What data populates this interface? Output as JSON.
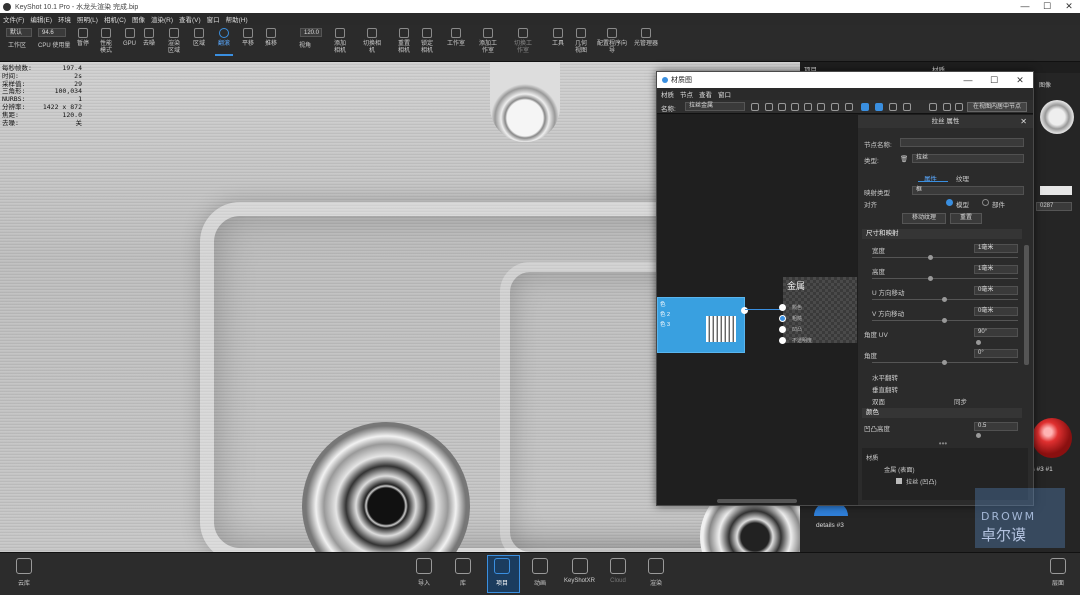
{
  "app": {
    "title": "KeyShot 10.1 Pro - 水龙头渲染 完成.bip"
  },
  "window_controls": [
    "—",
    "☐",
    "✕"
  ],
  "menu": [
    "文件(F)",
    "编辑(E)",
    "环境",
    "照明(L)",
    "相机(C)",
    "图像",
    "渲染(R)",
    "查看(V)",
    "窗口",
    "帮助(H)"
  ],
  "toolbar": {
    "workspace_select": "默认",
    "zoom_value": "94.6",
    "cpu_label": "CPU",
    "threshold_value": "120.0",
    "items": [
      {
        "label": "工作区"
      },
      {
        "label": "CPU 使用量"
      },
      {
        "label": "暂停"
      },
      {
        "label": "性能模式"
      },
      {
        "label": "GPU"
      },
      {
        "label": "去噪"
      },
      {
        "label": "渲染区域"
      },
      {
        "label": "区域"
      },
      {
        "label": "翻滚"
      },
      {
        "label": "平移"
      },
      {
        "label": "推移"
      },
      {
        "label": "视角"
      },
      {
        "label": "添加相机"
      },
      {
        "label": "切换相机"
      },
      {
        "label": "重置相机"
      },
      {
        "label": "锁定相机"
      },
      {
        "label": "工作室"
      },
      {
        "label": "添加工作室"
      },
      {
        "label": "切换工作室"
      },
      {
        "label": "工具"
      },
      {
        "label": "几何视图"
      },
      {
        "label": "配置程序向导"
      },
      {
        "label": "光管理器"
      }
    ]
  },
  "stats": [
    {
      "label": "每秒帧数:",
      "value": "197.4"
    },
    {
      "label": "时间:",
      "value": "2s"
    },
    {
      "label": "采样值:",
      "value": "29"
    },
    {
      "label": "三角形:",
      "value": "100,034"
    },
    {
      "label": "NURBS:",
      "value": "1"
    },
    {
      "label": "分辨率:",
      "value": "1422 x 872"
    },
    {
      "label": "焦距:",
      "value": "120.0"
    },
    {
      "label": "去噪:",
      "value": "关"
    }
  ],
  "side_panel": {
    "tab_project": "项目",
    "tab_material": "材质",
    "image_label": "图像",
    "value_field": "0287",
    "details_label": "details #3",
    "details_label2": "ls #3 #1"
  },
  "material_window": {
    "title": "材质图",
    "menu": [
      "材质",
      "节点",
      "查看",
      "窗口"
    ],
    "name_label": "名称:",
    "name_value": "拉丝金属",
    "center_button": "在视图内居中节点",
    "texture_node": {
      "ports": [
        "色",
        "色 2",
        "色 3"
      ]
    },
    "metal_node": {
      "title": "金属",
      "ports": [
        "颜色",
        "粗糙",
        "凹凸",
        "不透明度"
      ]
    },
    "props": {
      "header": "拉丝 属性",
      "node_name_label": "节点名称:",
      "type_label": "类型:",
      "type_value": "拉丝",
      "tab_props": "属性",
      "tab_texture": "纹理",
      "mapping_label": "映射类型",
      "mapping_value": "框",
      "coord_label": "对齐",
      "coord_opt1": "模型",
      "coord_opt2": "部件",
      "move_btn": "移动纹理",
      "reset_btn": "重置",
      "section_size": "尺寸和映射",
      "width_label": "宽度",
      "width_value": "1毫米",
      "height_label": "高度",
      "height_value": "1毫米",
      "u_label": "U 方向移动",
      "u_value": "0毫米",
      "v_label": "V 方向移动",
      "v_value": "0毫米",
      "angle_uv_label": "角度 UV",
      "angle_uv_value": "90°",
      "angle_label": "角度",
      "angle_value": "0°",
      "flip_h": "水平翻转",
      "flip_v": "垂直翻转",
      "repeat_label": "双面",
      "sync_label": "同步",
      "section_color": "颜色",
      "bump_label": "凹凸高度",
      "bump_value": "0.5",
      "dots": "•••",
      "tree": [
        "材质",
        "金属 (表面)",
        "拉丝 (凹凸)"
      ]
    }
  },
  "bottom_bar": {
    "left_label": "云库",
    "right_label": "层面",
    "items": [
      {
        "label": "导入"
      },
      {
        "label": "库"
      },
      {
        "label": "项目"
      },
      {
        "label": "动画"
      },
      {
        "label": "KeyShotXR"
      },
      {
        "label": "Cloud"
      },
      {
        "label": "渲染"
      }
    ]
  },
  "watermark": {
    "line1": "DROWM",
    "line2": "卓尔谟"
  },
  "colors": {
    "accent": "#3a8fe0",
    "texture_node": "#39a0e0",
    "background": "#1b1b1b"
  }
}
